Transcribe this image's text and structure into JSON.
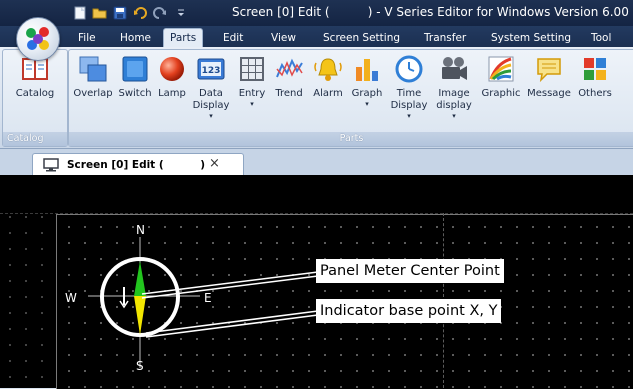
{
  "title_bar": {
    "title": "Screen [0] Edit (          ) - V Series Editor for Windows Version 6.00",
    "quick_access": [
      "new-icon",
      "open-icon",
      "save-icon",
      "undo-icon",
      "redo-icon",
      "qat-dropdown-icon"
    ]
  },
  "menu_tabs": [
    "File",
    "Home",
    "Parts",
    "Edit",
    "View",
    "Screen Setting",
    "Transfer",
    "System Setting",
    "Tool"
  ],
  "active_tab": "Parts",
  "ribbon": {
    "catalog_group": {
      "label": "Catalog",
      "items": [
        {
          "label": "Catalog",
          "icon": "catalog-icon"
        }
      ]
    },
    "parts_group": {
      "label": "Parts",
      "items": [
        {
          "label": "Overlap",
          "icon": "overlap-icon",
          "dropdown": false
        },
        {
          "label": "Switch",
          "icon": "switch-icon",
          "dropdown": false
        },
        {
          "label": "Lamp",
          "icon": "lamp-icon",
          "dropdown": false
        },
        {
          "label": "Data Display",
          "line1": "Data",
          "line2": "Display",
          "icon": "data-display-icon",
          "dropdown": true
        },
        {
          "label": "Entry",
          "icon": "entry-icon",
          "dropdown": true
        },
        {
          "label": "Trend",
          "icon": "trend-icon",
          "dropdown": false
        },
        {
          "label": "Alarm",
          "icon": "alarm-icon",
          "dropdown": false
        },
        {
          "label": "Graph",
          "icon": "graph-icon",
          "dropdown": true
        },
        {
          "label": "Time Display",
          "line1": "Time",
          "line2": "Display",
          "icon": "time-display-icon",
          "dropdown": true
        },
        {
          "label": "Image display",
          "line1": "Image",
          "line2": "display",
          "icon": "image-display-icon",
          "dropdown": true
        },
        {
          "label": "Graphic",
          "icon": "graphic-icon",
          "dropdown": false
        },
        {
          "label": "Message",
          "icon": "message-icon",
          "dropdown": false
        },
        {
          "label": "Others",
          "icon": "others-icon",
          "dropdown": false
        }
      ]
    }
  },
  "document_tab": {
    "label": "Screen [0] Edit (          )",
    "close": "×"
  },
  "canvas": {
    "compass": {
      "north": "N",
      "south": "S",
      "east": "E",
      "west": "W"
    },
    "callouts": {
      "panel_meter_center": "Panel Meter Center Point",
      "indicator_base": "Indicator base point X, Y"
    }
  },
  "colors": {
    "title_bar": "#1e3152",
    "ribbon_bg": "#dae4f0",
    "canvas_bg": "#000000",
    "needle_green": "#22c51e",
    "needle_yellow": "#f2e600",
    "compass_ring": "#ffffff"
  }
}
